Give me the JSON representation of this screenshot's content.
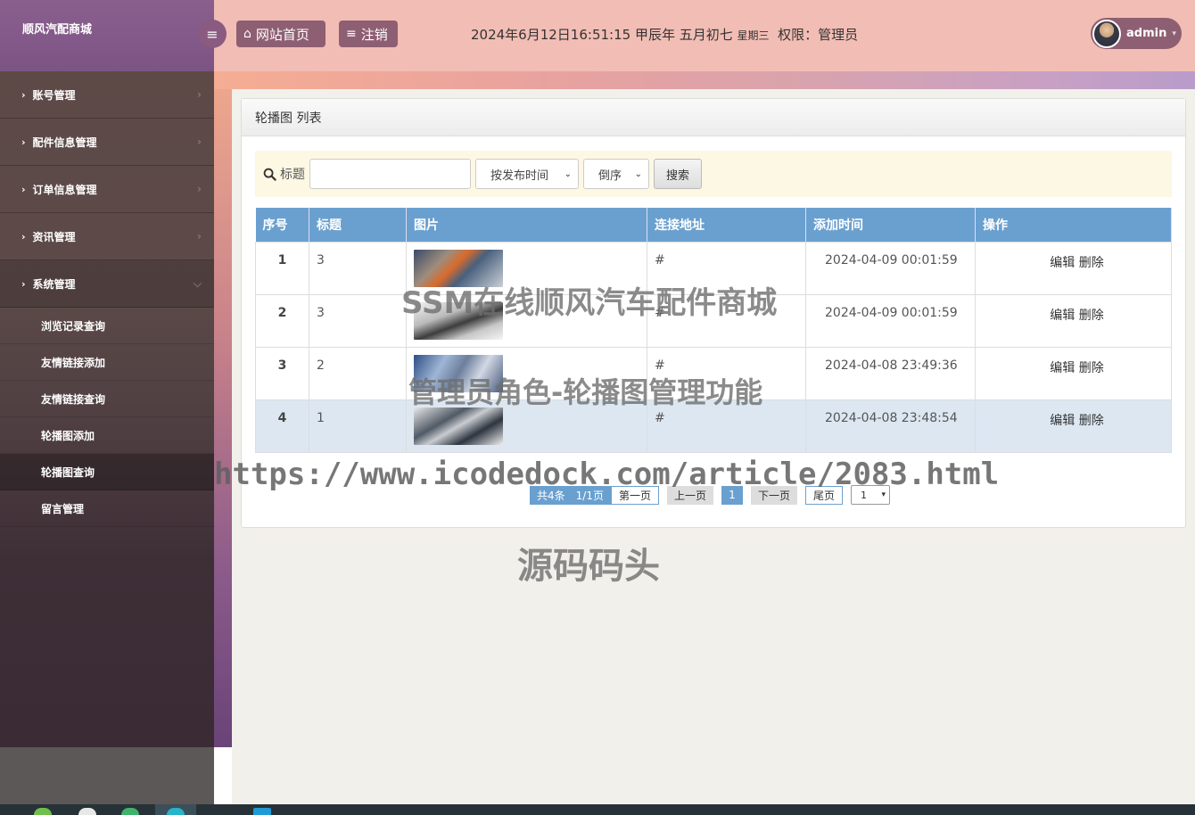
{
  "brand": "顺风汽配商城",
  "sidebar": {
    "items": [
      {
        "label": "账号管理"
      },
      {
        "label": "配件信息管理"
      },
      {
        "label": "订单信息管理"
      },
      {
        "label": "资讯管理"
      },
      {
        "label": "系统管理"
      }
    ],
    "sub_items": [
      {
        "label": "浏览记录查询"
      },
      {
        "label": "友情链接添加"
      },
      {
        "label": "友情链接查询"
      },
      {
        "label": "轮播图添加"
      },
      {
        "label": "轮播图查询"
      },
      {
        "label": "留言管理"
      }
    ]
  },
  "header": {
    "home_label": "网站首页",
    "logout_label": "注销",
    "datetime": "2024年6月12日16:51:15 甲辰年 五月初七",
    "weekday": "星期三",
    "role": "权限：管理员",
    "username": "admin"
  },
  "panel": {
    "title": "轮播图 列表"
  },
  "search": {
    "label": "标题",
    "input_value": "",
    "sort_field": "按发布时间",
    "sort_order": "倒序",
    "button_label": "搜索"
  },
  "table": {
    "headers": [
      "序号",
      "标题",
      "图片",
      "连接地址",
      "添加时间",
      "操作"
    ],
    "rows": [
      {
        "num": "1",
        "title": "3",
        "link": "#",
        "time": "2024-04-09 00:01:59",
        "edit": "编辑",
        "delete": "删除"
      },
      {
        "num": "2",
        "title": "3",
        "link": "#",
        "time": "2024-04-09 00:01:59",
        "edit": "编辑",
        "delete": "删除"
      },
      {
        "num": "3",
        "title": "2",
        "link": "#",
        "time": "2024-04-08 23:49:36",
        "edit": "编辑",
        "delete": "删除"
      },
      {
        "num": "4",
        "title": "1",
        "link": "#",
        "time": "2024-04-08 23:48:54",
        "edit": "编辑",
        "delete": "删除"
      }
    ]
  },
  "pager": {
    "info": "共4条　1/1页",
    "first": "第一页",
    "prev": "上一页",
    "current": "1",
    "next": "下一页",
    "last": "尾页",
    "select_value": "1"
  },
  "watermarks": {
    "line1": "SSM在线顺风汽车配件商城",
    "line2": "管理员角色-轮播图管理功能",
    "line3": "https://www.icodedock.com/article/2083.html",
    "line4": "源码码头"
  },
  "colors": {
    "table_header": "#6aa0cf",
    "header_btn": "#8e5f72",
    "brand_bg": "#8a5f8e"
  }
}
